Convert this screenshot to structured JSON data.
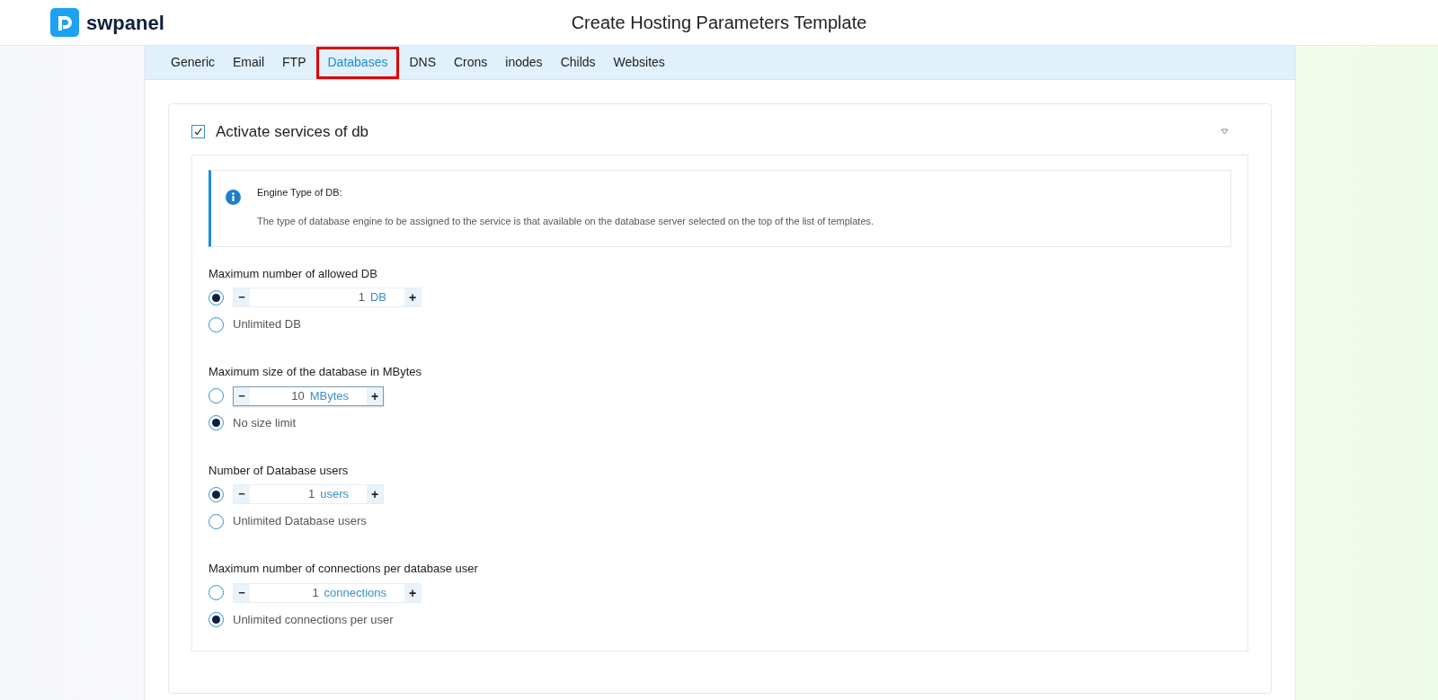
{
  "header": {
    "logo_text": "swpanel",
    "title": "Create Hosting Parameters Template"
  },
  "tabs": [
    {
      "label": "Generic",
      "selected": false
    },
    {
      "label": "Email",
      "selected": false
    },
    {
      "label": "FTP",
      "selected": false
    },
    {
      "label": "Databases",
      "selected": true
    },
    {
      "label": "DNS",
      "selected": false
    },
    {
      "label": "Crons",
      "selected": false
    },
    {
      "label": "inodes",
      "selected": false
    },
    {
      "label": "Childs",
      "selected": false
    },
    {
      "label": "Websites",
      "selected": false
    }
  ],
  "section": {
    "title": "Activate services of db",
    "checked": true,
    "info": {
      "title": "Engine Type of DB:",
      "text": "The type of database engine to be assigned to the service is that available on the database server selected on the top of the list of templates."
    },
    "groups": [
      {
        "label": "Maximum number of allowed DB",
        "options": [
          {
            "kind": "stepper",
            "selected": true,
            "minus": "−",
            "value": "1",
            "unit": "DB",
            "plus": "+",
            "focused": false,
            "wide": true
          },
          {
            "kind": "text",
            "selected": false,
            "label": "Unlimited DB"
          }
        ]
      },
      {
        "label": "Maximum size of the database in MBytes",
        "options": [
          {
            "kind": "stepper",
            "selected": false,
            "minus": "−",
            "value": "10",
            "unit": "MBytes",
            "plus": "+",
            "focused": true,
            "wide": false
          },
          {
            "kind": "text",
            "selected": true,
            "label": "No size limit"
          }
        ]
      },
      {
        "label": "Number of Database users",
        "options": [
          {
            "kind": "stepper",
            "selected": true,
            "minus": "−",
            "value": "1",
            "unit": "users",
            "plus": "+",
            "focused": false,
            "wide": false
          },
          {
            "kind": "text",
            "selected": false,
            "label": "Unlimited Database users"
          }
        ]
      },
      {
        "label": "Maximum number of connections per database user",
        "options": [
          {
            "kind": "stepper",
            "selected": false,
            "minus": "−",
            "value": "1",
            "unit": "connections",
            "plus": "+",
            "focused": false,
            "wide": true
          },
          {
            "kind": "text",
            "selected": true,
            "label": "Unlimited connections per user"
          }
        ]
      }
    ]
  }
}
